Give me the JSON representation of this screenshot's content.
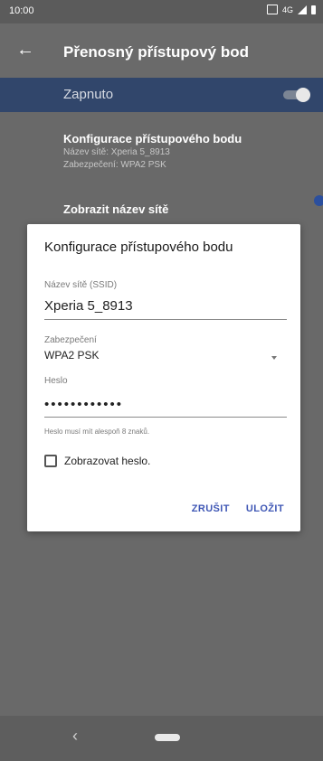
{
  "status": {
    "time": "10:00",
    "network": "4G"
  },
  "appbar": {
    "title": "Přenosný přístupový bod"
  },
  "toggle": {
    "label": "Zapnuto"
  },
  "settings": {
    "config_title": "Konfigurace přístupového bodu",
    "config_sub1": "Název sítě: Xperia 5_8913",
    "config_sub2": "Zabezpečení: WPA2 PSK",
    "show_name_title": "Zobrazit název sítě"
  },
  "dialog": {
    "title": "Konfigurace přístupového bodu",
    "ssid_label": "Název sítě (SSID)",
    "ssid_value": "Xperia 5_8913",
    "security_label": "Zabezpečení",
    "security_value": "WPA2 PSK",
    "password_label": "Heslo",
    "password_value": "••••••••••••",
    "password_hint": "Heslo musí mít alespoň 8 znaků.",
    "show_password": "Zobrazovat heslo.",
    "cancel": "ZRUŠIT",
    "save": "ULOŽIT"
  },
  "colors": {
    "accent": "#3f57b5",
    "toggle_row": "#31466b"
  }
}
